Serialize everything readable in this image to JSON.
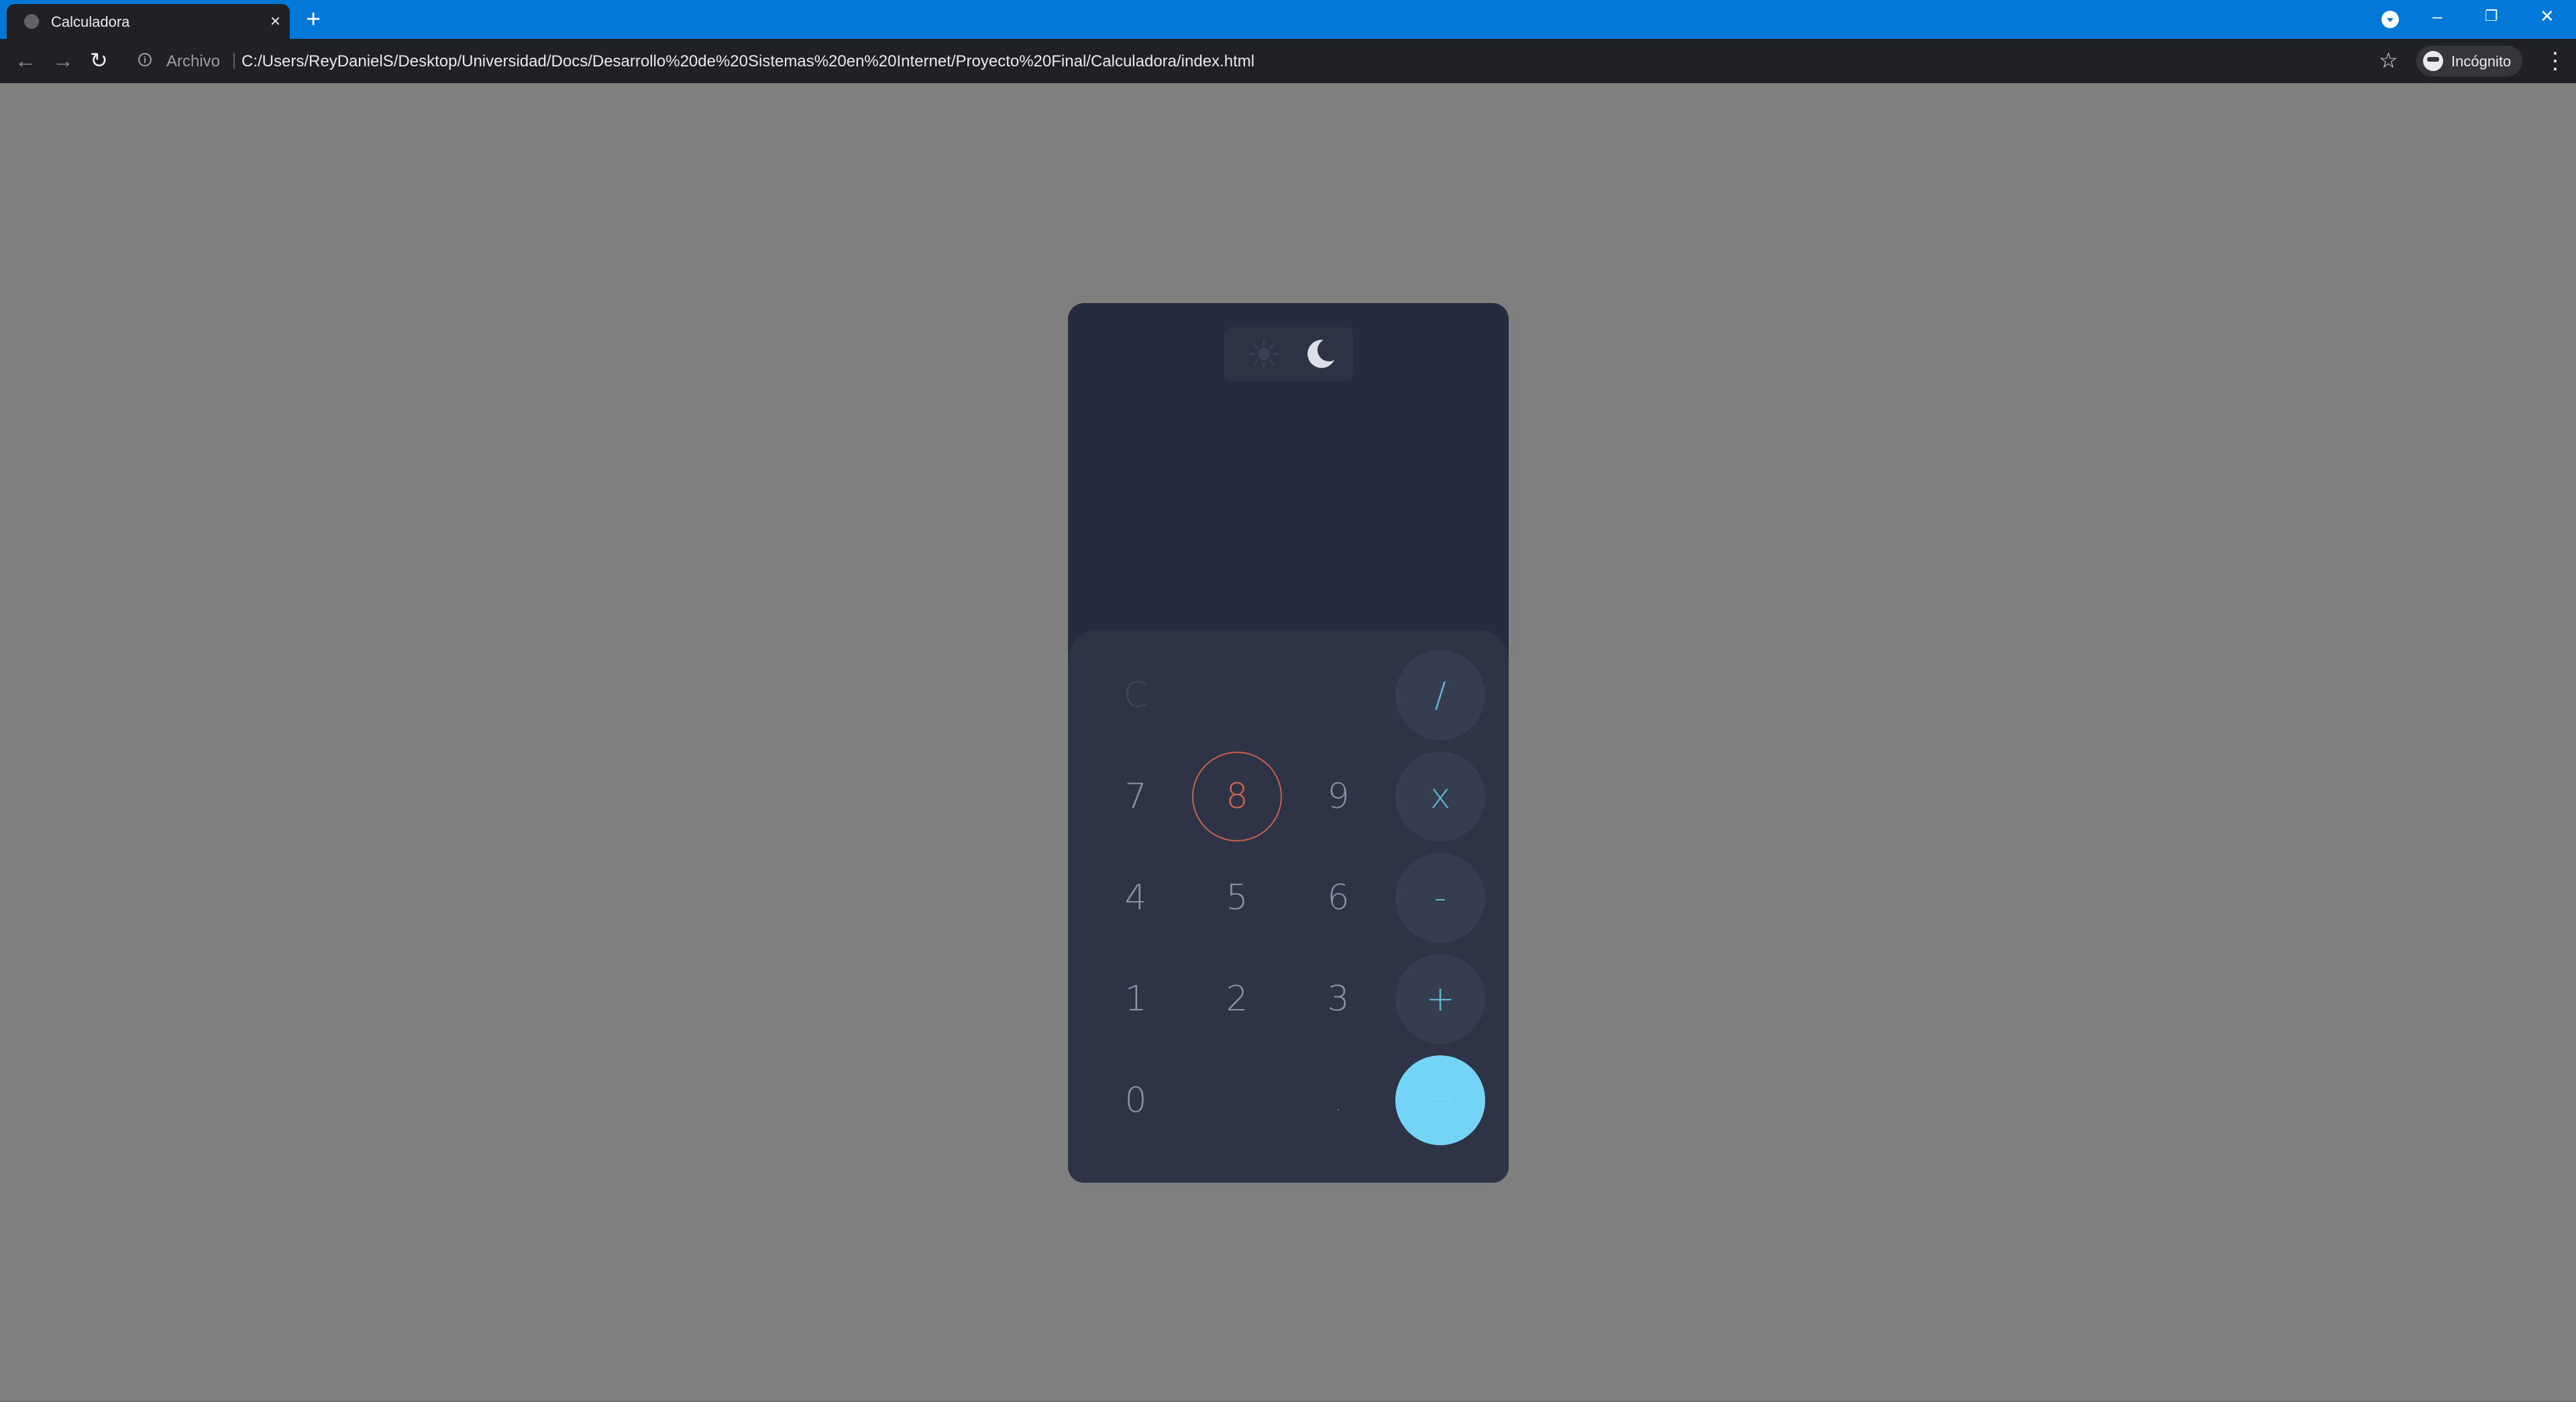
{
  "browser": {
    "tab_title": "Calculadora",
    "tab_close": "×",
    "new_tab": "+",
    "minimize": "–",
    "restore": "❐",
    "close": "✕",
    "back": "←",
    "forward": "→",
    "reload": "↻",
    "info": "i",
    "scheme_label": "Archivo",
    "url": "C:/Users/ReyDanielS/Desktop/Universidad/Docs/Desarrollo%20de%20Sistemas%20en%20Internet/Proyecto%20Final/Calculadora/index.html",
    "star": "☆",
    "profile_label": "Incógnito",
    "menu": "⋮"
  },
  "calculator": {
    "display": "",
    "theme_toggle": {
      "light_icon": "sun-icon",
      "dark_icon": "moon-icon",
      "active": "dark"
    },
    "keys": {
      "clear": "C",
      "divide": "/",
      "seven": "7",
      "eight": "8",
      "nine": "9",
      "multiply": "x",
      "four": "4",
      "five": "5",
      "six": "6",
      "subtract": "-",
      "one": "1",
      "two": "2",
      "three": "3",
      "add": "+",
      "zero": "0",
      "decimal": ".",
      "equals": "="
    },
    "highlighted_key": "8",
    "colors": {
      "page_background": "#7f7f7f",
      "calc_background": "#262c3f",
      "keypad_background": "#2e3446",
      "operator_background": "#373d50",
      "operator_text": "#61b5d5",
      "equals_background": "#73d4f6",
      "highlight": "#c7604c"
    }
  }
}
